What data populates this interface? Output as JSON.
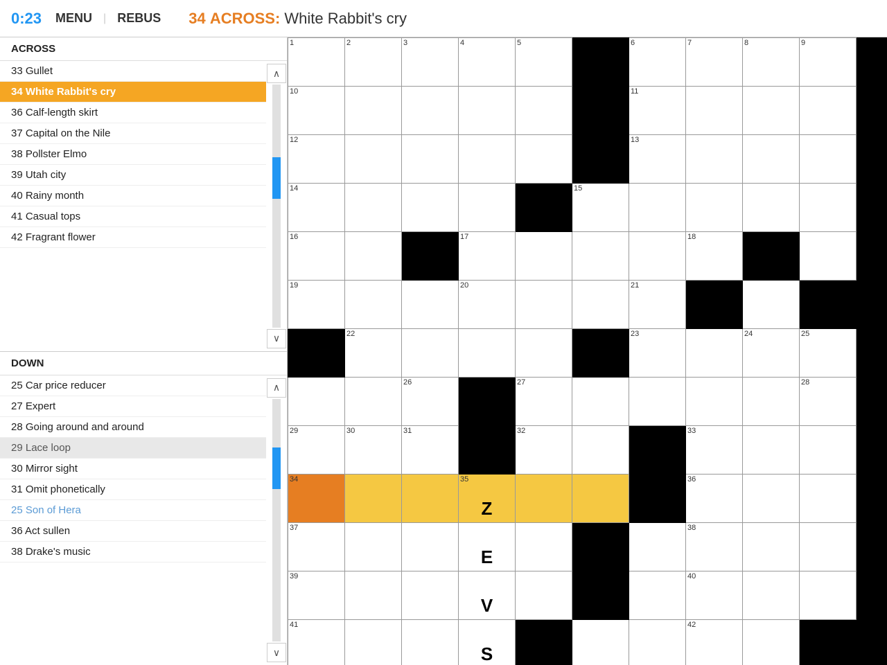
{
  "header": {
    "timer": "0:23",
    "menu_label": "MENU",
    "rebus_label": "REBUS",
    "clue_number": "34",
    "clue_direction": "ACROSS",
    "clue_text": "White Rabbit's cry"
  },
  "across_section": {
    "label": "ACROSS",
    "clues": [
      {
        "num": "33",
        "text": "Gullet",
        "state": "normal"
      },
      {
        "num": "34",
        "text": "White Rabbit's cry",
        "state": "active"
      },
      {
        "num": "36",
        "text": "Calf-length skirt",
        "state": "normal"
      },
      {
        "num": "37",
        "text": "Capital on the Nile",
        "state": "normal"
      },
      {
        "num": "38",
        "text": "Pollster Elmo",
        "state": "normal"
      },
      {
        "num": "39",
        "text": "Utah city",
        "state": "normal"
      },
      {
        "num": "40",
        "text": "Rainy month",
        "state": "normal"
      },
      {
        "num": "41",
        "text": "Casual tops",
        "state": "normal"
      },
      {
        "num": "42",
        "text": "Fragrant flower",
        "state": "normal"
      }
    ]
  },
  "down_section": {
    "label": "DOWN",
    "clues": [
      {
        "num": "25",
        "text": "Car price reducer",
        "state": "normal"
      },
      {
        "num": "27",
        "text": "Expert",
        "state": "normal"
      },
      {
        "num": "28",
        "text": "Going around and around",
        "state": "normal"
      },
      {
        "num": "29",
        "text": "Lace loop",
        "state": "highlighted"
      },
      {
        "num": "30",
        "text": "Mirror sight",
        "state": "normal"
      },
      {
        "num": "31",
        "text": "Omit phonetically",
        "state": "normal"
      },
      {
        "num": "25",
        "text": "Son of Hera",
        "state": "muted"
      },
      {
        "num": "36",
        "text": "Act sullen",
        "state": "normal"
      },
      {
        "num": "38",
        "text": "Drake's music",
        "state": "normal"
      }
    ]
  },
  "grid": {
    "cells": [
      [
        "white",
        "white",
        "white",
        "white",
        "white",
        "black",
        "white",
        "white",
        "white",
        "white"
      ],
      [
        "white",
        "white",
        "white",
        "white",
        "white",
        "black",
        "white",
        "white",
        "white",
        "white"
      ],
      [
        "white",
        "white",
        "white",
        "white",
        "white",
        "black",
        "white",
        "white",
        "white",
        "white"
      ],
      [
        "white",
        "white",
        "white",
        "white",
        "black",
        "white",
        "white",
        "white",
        "black",
        "white"
      ],
      [
        "white",
        "white",
        "black",
        "white",
        "white",
        "white",
        "white",
        "white",
        "black",
        "white"
      ],
      [
        "white",
        "white",
        "white",
        "white",
        "white",
        "white",
        "white",
        "black",
        "white",
        "black"
      ],
      [
        "black",
        "white",
        "white",
        "white",
        "white",
        "black",
        "white",
        "white",
        "white",
        "white"
      ],
      [
        "white",
        "white",
        "white",
        "black",
        "white",
        "white",
        "white",
        "white",
        "white",
        "white"
      ],
      [
        "active",
        "highlighted",
        "highlighted",
        "highlighted",
        "highlighted",
        "highlighted",
        "black",
        "white",
        "white",
        "white"
      ],
      [
        "white",
        "white",
        "white",
        "white",
        "white",
        "white",
        "white",
        "black",
        "white",
        "white"
      ],
      [
        "white",
        "white",
        "white",
        "white",
        "white",
        "black",
        "white",
        "white",
        "white",
        "white"
      ],
      [
        "white",
        "white",
        "white",
        "white",
        "white",
        "black",
        "white",
        "white",
        "white",
        "white"
      ],
      [
        "white",
        "white",
        "white",
        "white",
        "black",
        "white",
        "white",
        "white",
        "white",
        "black"
      ]
    ],
    "numbers": {
      "0,0": "1",
      "0,1": "2",
      "0,2": "3",
      "0,3": "4",
      "0,4": "5",
      "0,6": "6",
      "0,7": "7",
      "0,8": "8",
      "0,9": "9",
      "1,0": "10",
      "1,6": "11",
      "2,0": "12",
      "2,6": "13",
      "3,0": "14",
      "3,5": "15",
      "4,0": "16",
      "4,3": "17",
      "4,7": "18",
      "5,0": "19",
      "5,3": "20",
      "5,6": "21",
      "6,1": "22",
      "6,6": "23",
      "6,8": "24",
      "6,9": "25",
      "7,2": "26",
      "7,4": "27",
      "7,9": "28",
      "8,0": "29",
      "8,1": "30",
      "8,2": "31",
      "8,4": "32",
      "8,7": "33",
      "9,0": "34",
      "9,3": "35",
      "9,7": "36",
      "10,0": "37",
      "10,7": "38",
      "11,0": "39",
      "11,7": "40",
      "12,0": "41",
      "12,7": "42"
    },
    "letters": {
      "9,3": "Z",
      "10,3": "E",
      "11,3": "V",
      "12,3": "S"
    }
  },
  "colors": {
    "active": "#E67E22",
    "highlighted": "#F5C842",
    "accent_blue": "#2196F3",
    "black": "#000000",
    "white": "#FFFFFF"
  }
}
